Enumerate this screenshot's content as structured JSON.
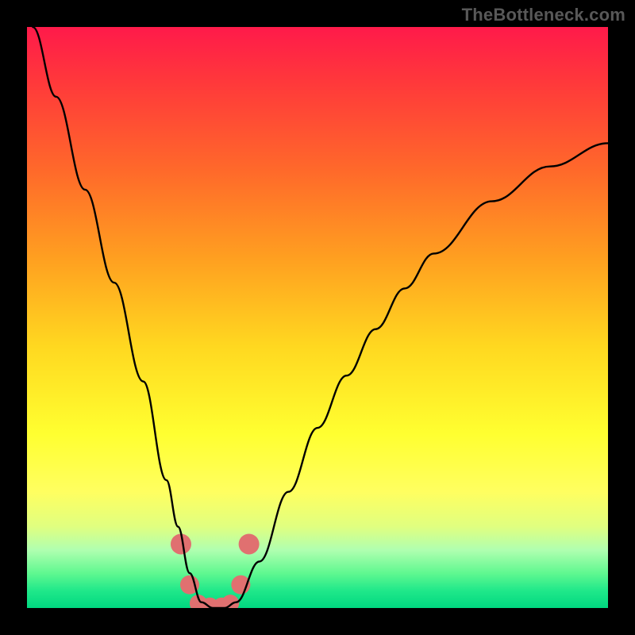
{
  "watermark": "TheBottleneck.com",
  "chart_data": {
    "type": "line",
    "title": "",
    "xlabel": "",
    "ylabel": "",
    "xlim": [
      0,
      100
    ],
    "ylim": [
      0,
      100
    ],
    "grid": false,
    "legend": null,
    "series": [
      {
        "name": "curve",
        "x": [
          1,
          5,
          10,
          15,
          20,
          24,
          26,
          28,
          30,
          32,
          34,
          36,
          40,
          45,
          50,
          55,
          60,
          65,
          70,
          80,
          90,
          100
        ],
        "y": [
          100,
          88,
          72,
          56,
          39,
          22,
          14,
          6,
          1,
          0,
          0,
          1,
          8,
          20,
          31,
          40,
          48,
          55,
          61,
          70,
          76,
          80
        ]
      }
    ],
    "markers": {
      "name": "highlight-dots",
      "color": "#e07070",
      "x": [
        26.5,
        28.0,
        29.5,
        31.5,
        33.5,
        35.0,
        36.8,
        38.2
      ],
      "y": [
        11.0,
        4.0,
        0.8,
        0.3,
        0.3,
        0.8,
        4.0,
        11.0
      ],
      "r": [
        13,
        12,
        11,
        11,
        11,
        11,
        12,
        13
      ]
    }
  }
}
